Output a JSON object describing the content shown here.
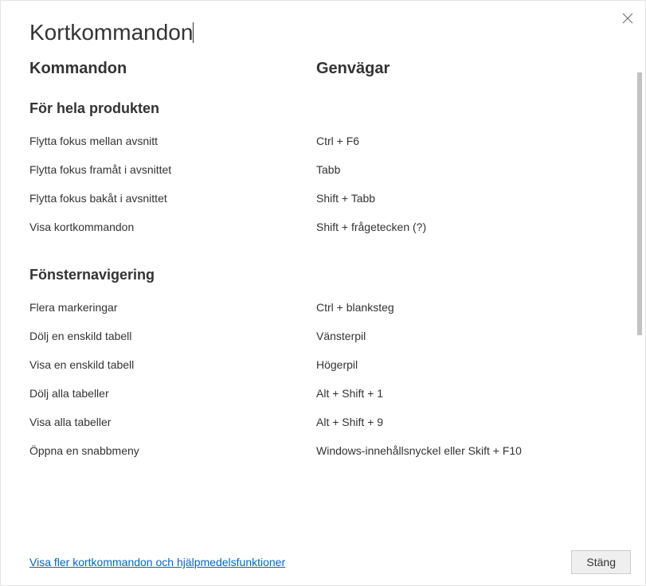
{
  "dialog": {
    "title": "Kortkommandon",
    "commands_header": "Kommandon",
    "shortcuts_header": "Genvägar",
    "footer_link": "Visa fler kortkommandon och hjälpmedelsfunktioner",
    "close_button": "Stäng"
  },
  "sections": [
    {
      "title": "För hela produkten",
      "rows": [
        {
          "command": "Flytta fokus mellan avsnitt",
          "shortcut": "Ctrl + F6"
        },
        {
          "command": "Flytta fokus framåt i avsnittet",
          "shortcut": "Tabb"
        },
        {
          "command": "Flytta fokus bakåt i avsnittet",
          "shortcut": "Shift + Tabb"
        },
        {
          "command": "Visa kortkommandon",
          "shortcut": "Shift + frågetecken (?)"
        }
      ]
    },
    {
      "title": "Fönsternavigering",
      "rows": [
        {
          "command": "Flera markeringar",
          "shortcut": "Ctrl + blanksteg"
        },
        {
          "command": "Dölj en enskild tabell",
          "shortcut": "Vänsterpil"
        },
        {
          "command": "Visa en enskild tabell",
          "shortcut": "Högerpil"
        },
        {
          "command": "Dölj alla tabeller",
          "shortcut": "Alt + Shift + 1"
        },
        {
          "command": "Visa alla tabeller",
          "shortcut": "Alt + Shift + 9"
        },
        {
          "command": "Öppna en snabbmeny",
          "shortcut": "Windows-innehållsnyckel eller Skift + F10"
        }
      ]
    }
  ]
}
